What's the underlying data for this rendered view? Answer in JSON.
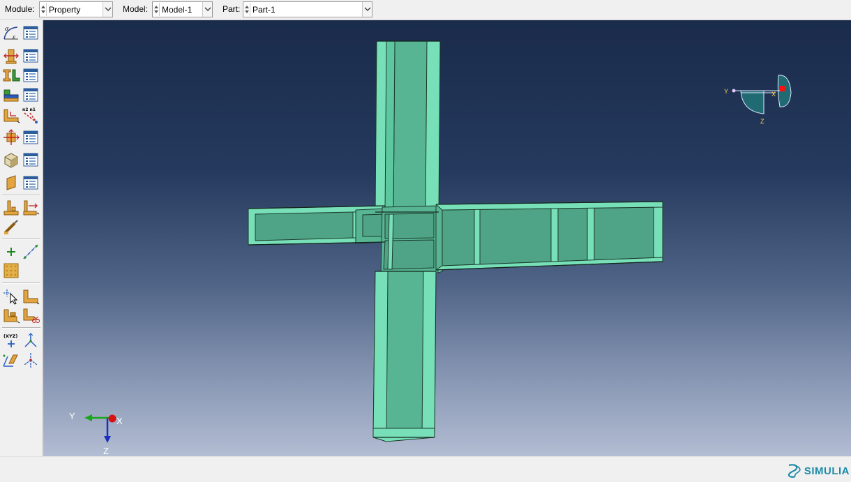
{
  "context": {
    "module_label": "Module:",
    "module_value": "Property",
    "model_label": "Model:",
    "model_value": "Model-1",
    "part_label": "Part:",
    "part_value": "Part-1"
  },
  "toolbox": {
    "tools": [
      {
        "name": "create-material-icon"
      },
      {
        "name": "material-manager-icon"
      },
      {
        "name": "create-section-icon"
      },
      {
        "name": "section-manager-icon"
      },
      {
        "name": "create-profile-icon"
      },
      {
        "name": "profile-manager-icon"
      },
      {
        "name": "assign-section-icon"
      },
      {
        "name": "section-assignment-manager-icon"
      },
      {
        "name": "assign-material-orientation-icon"
      },
      {
        "name": "assign-normal-icon"
      },
      {
        "name": "assign-beam-orientation-icon"
      },
      {
        "name": "orientation-manager-icon"
      },
      {
        "name": "create-composite-layup-icon"
      },
      {
        "name": "composite-layup-manager-icon"
      },
      {
        "name": "create-skin-icon"
      },
      {
        "name": "skin-manager-icon"
      },
      {
        "name": "special-inertia-icon"
      },
      {
        "name": "special-springs-icon"
      },
      {
        "name": "edit-stringer-icon"
      },
      {
        "name": "create-datum-point-icon"
      },
      {
        "name": "create-datum-axis-icon"
      },
      {
        "name": "create-datum-plane-icon"
      },
      {
        "name": "query-icon"
      },
      {
        "name": "partition-face-icon"
      },
      {
        "name": "partition-cell-icon"
      },
      {
        "name": "repair-icon"
      },
      {
        "name": "create-datum-csys-icon"
      },
      {
        "name": "datum-csys-triad-icon"
      },
      {
        "name": "create-point-coordinates-icon"
      },
      {
        "name": "datum-axis-triad-icon"
      }
    ]
  },
  "viewport": {
    "triad": {
      "x_label": "X",
      "y_label": "Y",
      "z_label": "Z"
    },
    "view_cube": {
      "x_label": "X",
      "y_label": "Y",
      "z_label": "Z"
    },
    "part_color": "#4fa386"
  },
  "brand": {
    "name": "SIMULIA",
    "color": "#1d8aa8"
  },
  "colors": {
    "viewport_top": "#1a2b4b",
    "viewport_bottom": "#b3bdd3"
  }
}
